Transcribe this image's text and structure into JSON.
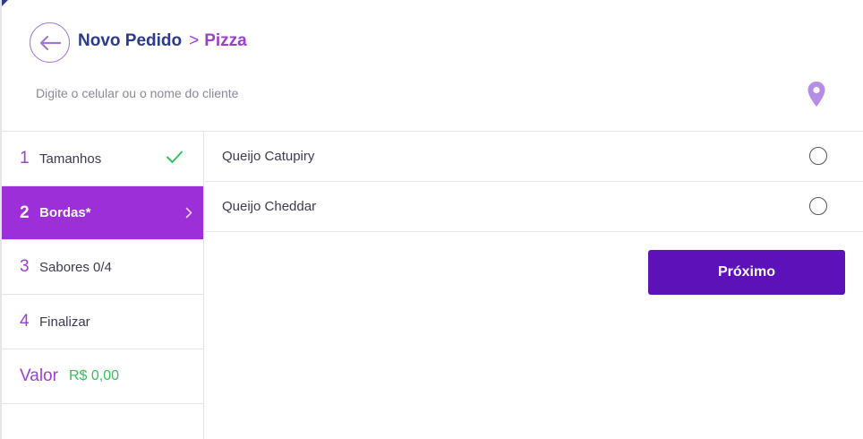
{
  "header": {
    "back_icon": "arrow-left-icon",
    "breadcrumb": {
      "main": "Novo Pedido",
      "separator": ">",
      "current": "Pizza"
    },
    "search": {
      "placeholder": "Digite o celular ou o nome do cliente",
      "value": ""
    },
    "location_icon": "map-pin-icon"
  },
  "steps": [
    {
      "num": "1",
      "label": "Tamanhos",
      "state": "done",
      "icon": "check-icon"
    },
    {
      "num": "2",
      "label": "Bordas*",
      "state": "active",
      "icon": "chevron-right-icon"
    },
    {
      "num": "3",
      "label": "Sabores 0/4",
      "state": "pending"
    },
    {
      "num": "4",
      "label": "Finalizar",
      "state": "pending"
    }
  ],
  "total": {
    "label": "Valor",
    "amount": "R$ 0,00"
  },
  "options": [
    {
      "label": "Queijo Catupiry",
      "selected": false
    },
    {
      "label": "Queijo Cheddar",
      "selected": false
    }
  ],
  "next_button": {
    "label": "Próximo"
  },
  "colors": {
    "brand_blue": "#2b3a8f",
    "accent_purple": "#9b3fcf",
    "active_step_bg": "#9d2fd8",
    "button_bg": "#5c12b8",
    "success_green": "#33c25a"
  }
}
